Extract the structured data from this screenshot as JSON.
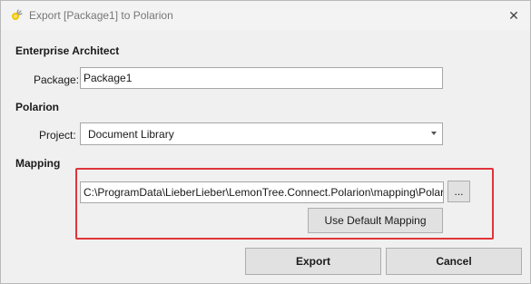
{
  "window": {
    "title": "Export [Package1] to Polarion",
    "icons": {
      "app": "lemontree-app-icon",
      "close": "close-icon"
    },
    "close_glyph": "✕"
  },
  "enterprise_architect": {
    "heading": "Enterprise Architect",
    "package_label": "Package:",
    "package_value": "Package1"
  },
  "polarion": {
    "heading": "Polarion",
    "project_label": "Project:",
    "project_selected": "Document Library",
    "dropdown_icon": "chevron-down-icon"
  },
  "mapping": {
    "heading": "Mapping",
    "path_value": "C:\\ProgramData\\LieberLieber\\LemonTree.Connect.Polarion\\mapping\\Polarion",
    "browse_label": "...",
    "default_button": "Use Default Mapping",
    "highlight_color": "#e0343b"
  },
  "footer": {
    "export_label": "Export",
    "cancel_label": "Cancel"
  }
}
